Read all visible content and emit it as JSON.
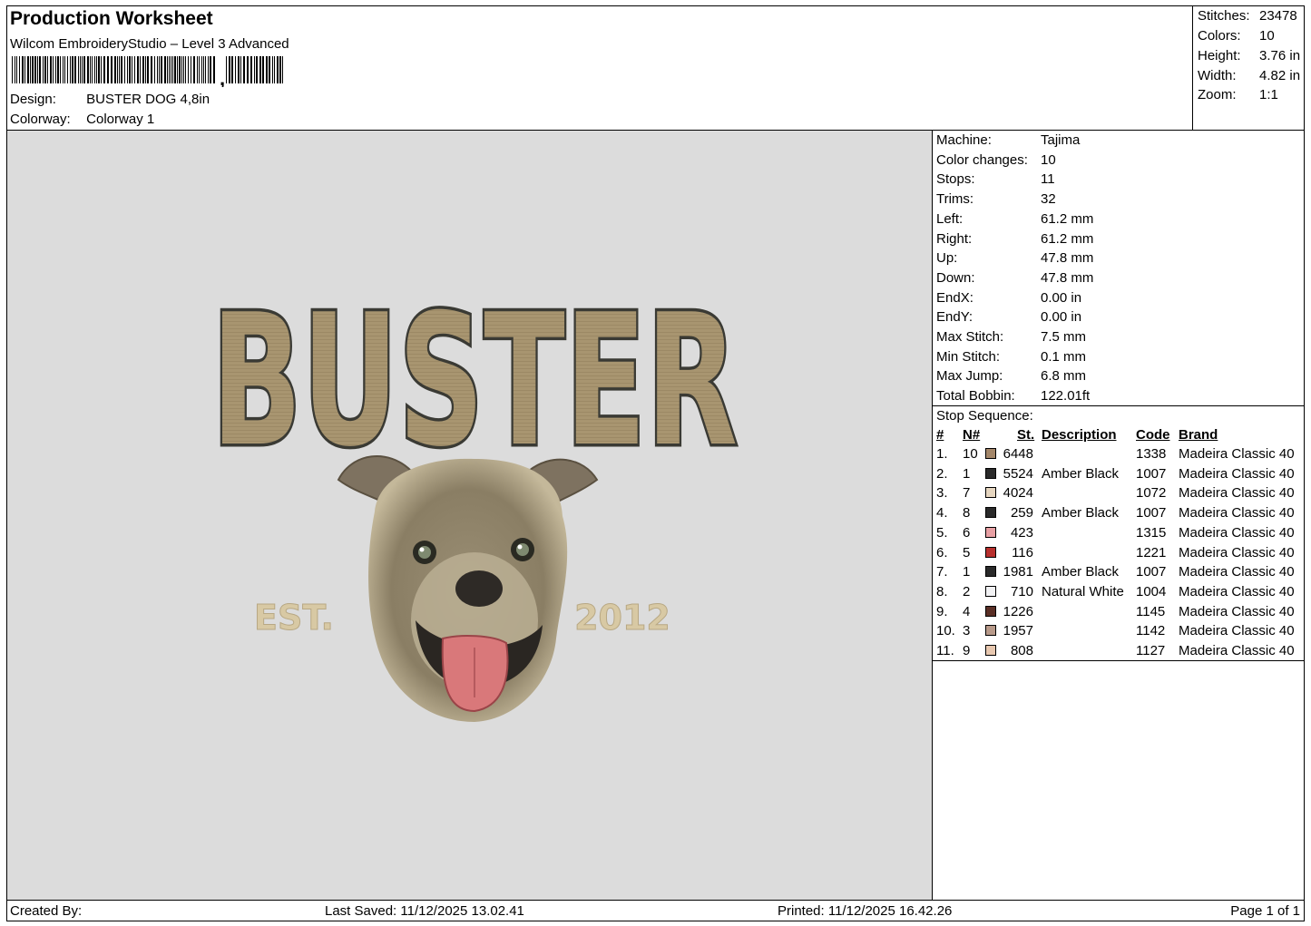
{
  "header": {
    "title": "Production Worksheet",
    "software": "Wilcom EmbroideryStudio – Level 3 Advanced",
    "barcode_text": ",",
    "design_label": "Design:",
    "design_value": "BUSTER DOG 4,8in",
    "colorway_label": "Colorway:",
    "colorway_value": "Colorway 1"
  },
  "stats": [
    {
      "label": "Stitches:",
      "value": "23478"
    },
    {
      "label": "Colors:",
      "value": "10"
    },
    {
      "label": "Height:",
      "value": "3.76 in"
    },
    {
      "label": "Width:",
      "value": "4.82 in"
    },
    {
      "label": "Zoom:",
      "value": "1:1"
    }
  ],
  "design_preview": {
    "text_main": "BUSTER",
    "text_left": "EST.",
    "text_right": "2012",
    "colors": {
      "background": "#dcdcdc",
      "letter_fill": "#a89570",
      "letter_outline": "#3a3a34",
      "est_text": "#d8c9a4",
      "fur": "#8c8066",
      "fur_light": "#c4b89a",
      "tongue": "#d9787a"
    }
  },
  "machine_info": [
    {
      "label": "Machine:",
      "value": "Tajima"
    },
    {
      "label": "Color changes:",
      "value": "10"
    },
    {
      "label": "Stops:",
      "value": "11"
    },
    {
      "label": "Trims:",
      "value": "32"
    },
    {
      "label": "Left:",
      "value": "61.2 mm"
    },
    {
      "label": "Right:",
      "value": "61.2 mm"
    },
    {
      "label": "Up:",
      "value": "47.8 mm"
    },
    {
      "label": "Down:",
      "value": "47.8 mm"
    },
    {
      "label": "EndX:",
      "value": "0.00 in"
    },
    {
      "label": "EndY:",
      "value": "0.00 in"
    },
    {
      "label": "Max Stitch:",
      "value": "7.5 mm"
    },
    {
      "label": "Min Stitch:",
      "value": "0.1 mm"
    },
    {
      "label": "Max Jump:",
      "value": "6.8 mm"
    },
    {
      "label": "Total Bobbin:",
      "value": "122.01ft"
    }
  ],
  "stop_sequence": {
    "title": "Stop Sequence:",
    "columns": {
      "index": "#",
      "needle": "N#",
      "stitches": "St.",
      "description": "Description",
      "code": "Code",
      "brand": "Brand"
    },
    "rows": [
      {
        "index": "1.",
        "needle": "10",
        "stitches": "6448",
        "description": "",
        "code": "1338",
        "brand": "Madeira Classic 40",
        "color": "#a4876a"
      },
      {
        "index": "2.",
        "needle": "1",
        "stitches": "5524",
        "description": "Amber Black",
        "code": "1007",
        "brand": "Madeira Classic 40",
        "color": "#2a2a2a"
      },
      {
        "index": "3.",
        "needle": "7",
        "stitches": "4024",
        "description": "",
        "code": "1072",
        "brand": "Madeira Classic 40",
        "color": "#e6d6c0"
      },
      {
        "index": "4.",
        "needle": "8",
        "stitches": "259",
        "description": "Amber Black",
        "code": "1007",
        "brand": "Madeira Classic 40",
        "color": "#2a2a2a"
      },
      {
        "index": "5.",
        "needle": "6",
        "stitches": "423",
        "description": "",
        "code": "1315",
        "brand": "Madeira Classic 40",
        "color": "#e8a0a4"
      },
      {
        "index": "6.",
        "needle": "5",
        "stitches": "116",
        "description": "",
        "code": "1221",
        "brand": "Madeira Classic 40",
        "color": "#b8302e"
      },
      {
        "index": "7.",
        "needle": "1",
        "stitches": "1981",
        "description": "Amber Black",
        "code": "1007",
        "brand": "Madeira Classic 40",
        "color": "#2a2a2a"
      },
      {
        "index": "8.",
        "needle": "2",
        "stitches": "710",
        "description": "Natural White",
        "code": "1004",
        "brand": "Madeira Classic 40",
        "color": "#f2f2f4"
      },
      {
        "index": "9.",
        "needle": "4",
        "stitches": "1226",
        "description": "",
        "code": "1145",
        "brand": "Madeira Classic 40",
        "color": "#5a2f26"
      },
      {
        "index": "10.",
        "needle": "3",
        "stitches": "1957",
        "description": "",
        "code": "1142",
        "brand": "Madeira Classic 40",
        "color": "#b89a8a"
      },
      {
        "index": "11.",
        "needle": "9",
        "stitches": "808",
        "description": "",
        "code": "1127",
        "brand": "Madeira Classic 40",
        "color": "#e8c8b0"
      }
    ]
  },
  "footer": {
    "created_by": "Created By:",
    "last_saved": "Last Saved: 11/12/2025 13.02.41",
    "printed": "Printed: 11/12/2025 16.42.26",
    "page": "Page 1 of 1"
  }
}
